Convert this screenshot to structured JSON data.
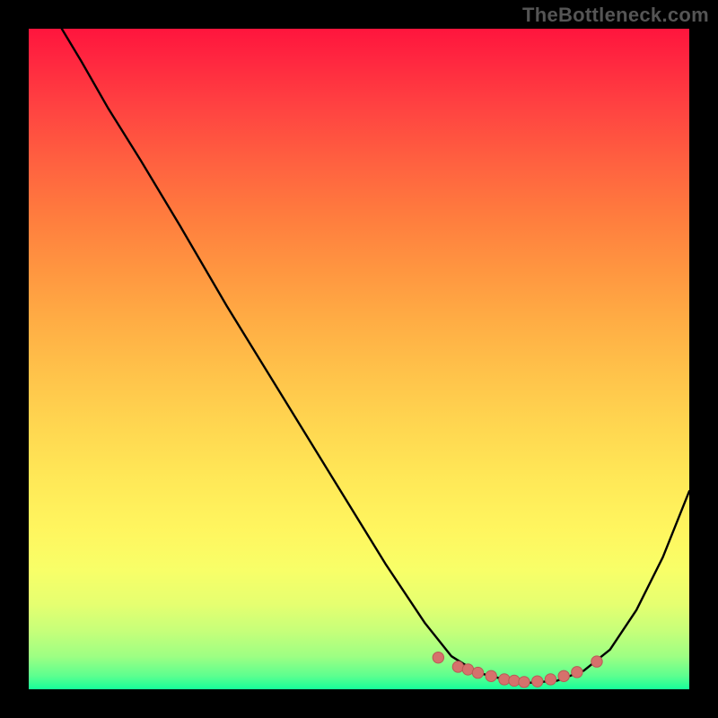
{
  "watermark": "TheBottleneck.com",
  "colors": {
    "background": "#000000",
    "curve": "#000000",
    "marker_fill": "#d6716c",
    "marker_stroke": "#b95a56",
    "gradient_top": "#ff153d",
    "gradient_bottom": "#16ff9a"
  },
  "chart_data": {
    "type": "line",
    "title": "",
    "xlabel": "",
    "ylabel": "",
    "xlim": [
      0,
      100
    ],
    "ylim": [
      0,
      100
    ],
    "grid": false,
    "legend": false,
    "series": [
      {
        "name": "bottleneck-curve",
        "x": [
          5,
          8,
          12,
          17,
          23,
          30,
          38,
          46,
          54,
          60,
          64,
          68,
          72,
          76,
          80,
          84,
          88,
          92,
          96,
          100
        ],
        "y": [
          100,
          95,
          88,
          80,
          70,
          58,
          45,
          32,
          19,
          10,
          5,
          2.5,
          1.5,
          1,
          1.3,
          2.8,
          6,
          12,
          20,
          30
        ]
      }
    ],
    "markers": {
      "name": "optimal-range",
      "x": [
        62,
        65,
        66.5,
        68,
        70,
        72,
        73.5,
        75,
        77,
        79,
        81,
        83,
        86
      ],
      "y": [
        4.8,
        3.4,
        3.0,
        2.5,
        2.0,
        1.5,
        1.3,
        1.1,
        1.2,
        1.5,
        2.0,
        2.6,
        4.2
      ]
    },
    "gradient_stops": [
      {
        "pos": 0.0,
        "color": "#ff153d"
      },
      {
        "pos": 0.5,
        "color": "#ffc24a"
      },
      {
        "pos": 0.8,
        "color": "#fff65f"
      },
      {
        "pos": 1.0,
        "color": "#16ff9a"
      }
    ]
  }
}
